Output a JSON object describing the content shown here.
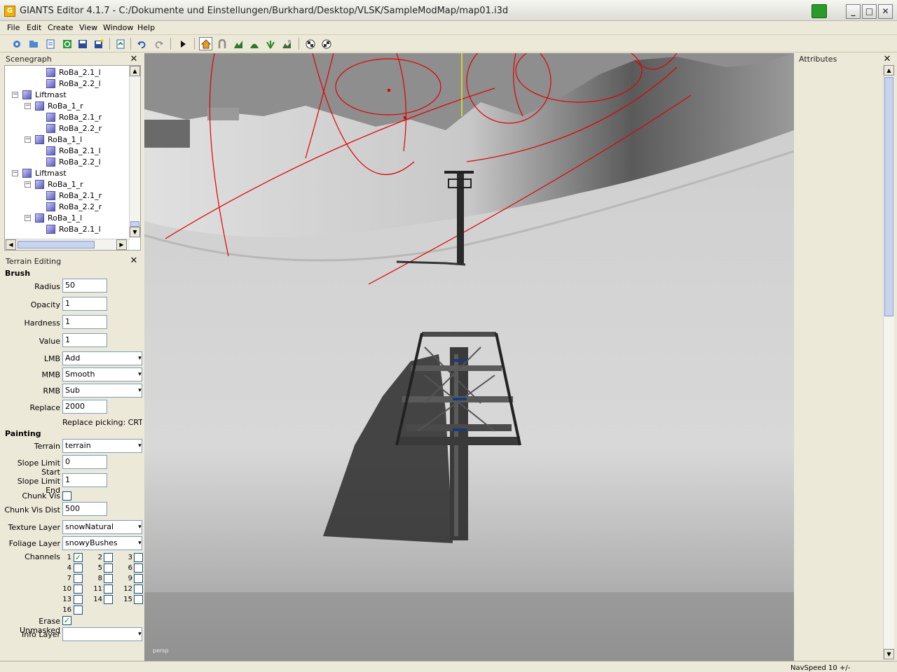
{
  "window": {
    "title": "GIANTS Editor 4.1.7 - C:/Dokumente und Einstellungen/Burkhard/Desktop/VLSK/SampleModMap/map01.i3d",
    "app_icon": "G"
  },
  "menu": [
    "File",
    "Edit",
    "Create",
    "View",
    "Window",
    "Help"
  ],
  "toolbar_icons": [
    "new-icon",
    "open-icon",
    "list-icon",
    "refresh-icon",
    "save-icon",
    "save-as-icon",
    "import-icon",
    "undo-icon",
    "redo-icon",
    "play-icon",
    "home-icon",
    "magnet-icon",
    "terrain-raise-icon",
    "terrain-smooth-icon",
    "foliage-icon",
    "texture-paint-icon",
    "checker-icon",
    "checker-settings-icon"
  ],
  "scenegraph": {
    "title": "Scenegraph",
    "items": [
      {
        "label": "RoBa_2.1_l",
        "level": 3
      },
      {
        "label": "RoBa_2.2_l",
        "level": 3
      },
      {
        "label": "Liftmast",
        "level": 1
      },
      {
        "label": "RoBa_1_r",
        "level": 2
      },
      {
        "label": "RoBa_2.1_r",
        "level": 3
      },
      {
        "label": "RoBa_2.2_r",
        "level": 3
      },
      {
        "label": "RoBa_1_l",
        "level": 2
      },
      {
        "label": "RoBa_2.1_l",
        "level": 3
      },
      {
        "label": "RoBa_2.2_l",
        "level": 3
      },
      {
        "label": "Liftmast",
        "level": 1
      },
      {
        "label": "RoBa_1_r",
        "level": 2
      },
      {
        "label": "RoBa_2.1_r",
        "level": 3
      },
      {
        "label": "RoBa_2.2_r",
        "level": 3
      },
      {
        "label": "RoBa_1_l",
        "level": 2
      },
      {
        "label": "RoBa_2.1_l",
        "level": 3
      }
    ]
  },
  "terrain": {
    "title": "Terrain Editing",
    "brush_heading": "Brush",
    "painting_heading": "Painting",
    "radius": {
      "label": "Radius",
      "value": "50"
    },
    "opacity": {
      "label": "Opacity",
      "value": "1"
    },
    "hardness": {
      "label": "Hardness",
      "value": "1"
    },
    "value": {
      "label": "Value",
      "value": "1"
    },
    "lmb": {
      "label": "LMB",
      "value": "Add"
    },
    "mmb": {
      "label": "MMB",
      "value": "Smooth"
    },
    "rmb": {
      "label": "RMB",
      "value": "Sub"
    },
    "replace": {
      "label": "Replace",
      "value": "2000"
    },
    "replace_hint": "Replace picking: CRTL-F",
    "terrain_sel": {
      "label": "Terrain",
      "value": "terrain"
    },
    "slope_start": {
      "label": "Slope Limit Start",
      "value": "0"
    },
    "slope_end": {
      "label": "Slope Limit End",
      "value": "1"
    },
    "chunk_vis": {
      "label": "Chunk Vis",
      "checked": false
    },
    "chunk_dist": {
      "label": "Chunk Vis Dist",
      "value": "500"
    },
    "texture_layer": {
      "label": "Texture Layer",
      "value": "snowNatural"
    },
    "foliage_layer": {
      "label": "Foliage Layer",
      "value": "snowyBushes"
    },
    "channels_label": "Channels",
    "channels": [
      "1",
      "2",
      "3",
      "4",
      "5",
      "6",
      "7",
      "8",
      "9",
      "10",
      "11",
      "12",
      "13",
      "14",
      "15",
      "16"
    ],
    "channel_checked": "1",
    "erase_unmasked": {
      "label": "Erase Unmasked",
      "checked": true
    },
    "info_layer": {
      "label": "Info Layer",
      "value": ""
    }
  },
  "viewport": {
    "camera_label": "persp"
  },
  "attributes": {
    "title": "Attributes"
  },
  "status": {
    "navspeed": "NavSpeed 10 +/-"
  },
  "colors": {
    "spline": "#e00000",
    "axis_marker": "#ffff00",
    "snow": "#d6d6d6",
    "sky": "#8e8e8e"
  }
}
